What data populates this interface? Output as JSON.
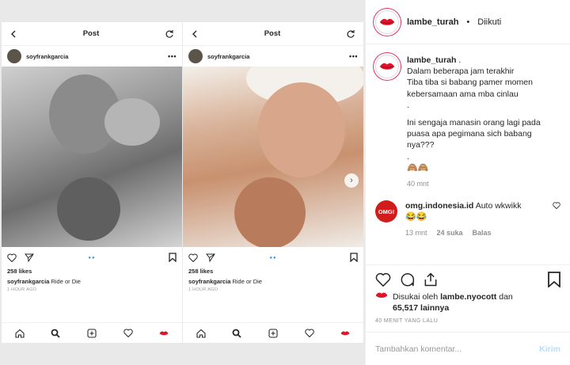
{
  "left_screens": [
    {
      "header_title": "Post",
      "username": "soyfrankgarcia",
      "likes": "258 likes",
      "caption_user": "soyfrankgarcia",
      "caption_text": "Ride or Die",
      "time": "1 HOUR AGO"
    },
    {
      "header_title": "Post",
      "username": "soyfrankgarcia",
      "likes": "258 likes",
      "caption_user": "soyfrankgarcia",
      "caption_text": "Ride or Die",
      "time": "1 HOUR AGO"
    }
  ],
  "header": {
    "username": "lambe_turah",
    "separator": "•",
    "follow_status": "Diikuti"
  },
  "caption": {
    "username": "lambe_turah",
    "suffix": ".",
    "lines": [
      "Dalam beberapa jam terakhir",
      "Tiba tiba si babang pamer momen",
      "kebersamaan ama mba cinlau",
      ".",
      "Ini sengaja manasin orang lagi pada",
      "puasa apa pegimana sich babang",
      "nya???",
      ".",
      "🙈🙈"
    ],
    "time": "40 mnt"
  },
  "comment": {
    "avatar_text": "OMG!",
    "username": "omg.indonesia.id",
    "text": "Auto wkwikk",
    "emoji": "😂😂",
    "time": "13 mnt",
    "likes": "24 suka",
    "reply": "Balas"
  },
  "liked_by": {
    "prefix": "Disukai oleh",
    "user": "lambe.nyocott",
    "and": "dan",
    "count": "65,517",
    "suffix": "lainnya"
  },
  "post_time": "40 MENIT YANG LALU",
  "add_comment": {
    "placeholder": "Tambahkan komentar...",
    "send_label": "Kirim"
  },
  "colors": {
    "link": "#3897f0",
    "muted": "#8e8e8e",
    "lips": "#e0142a",
    "send_disabled": "#b2dffc"
  }
}
